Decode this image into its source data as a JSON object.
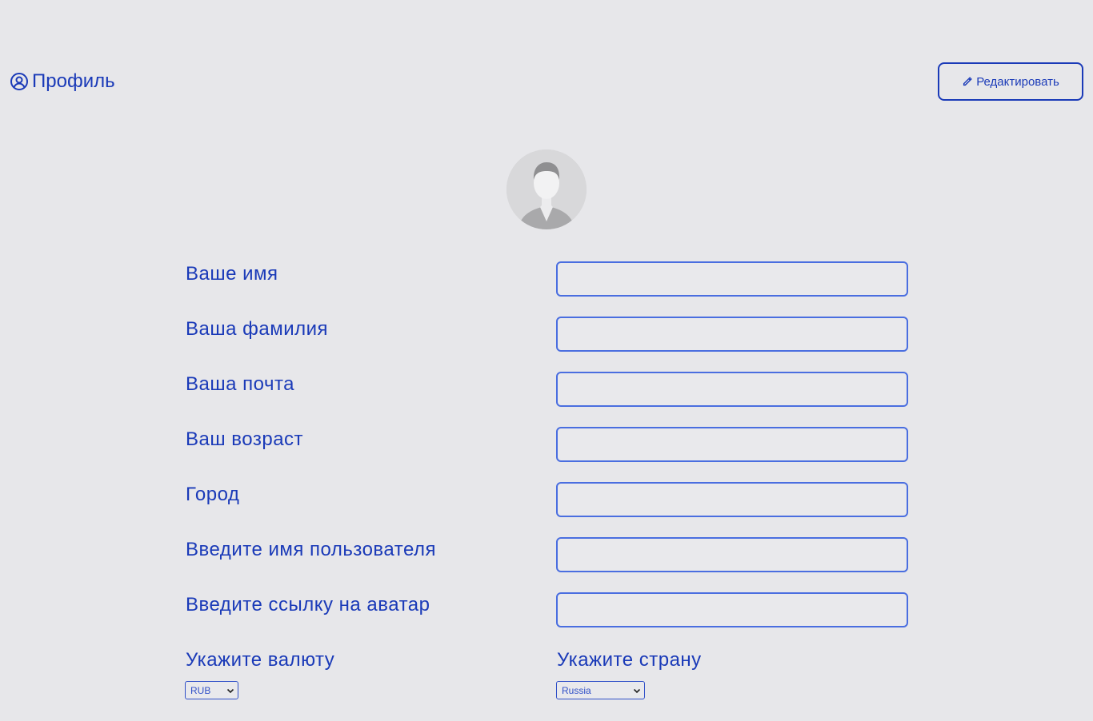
{
  "header": {
    "title": "Профиль",
    "title_icon": "user-circle-icon",
    "edit_label": "Редактировать",
    "edit_icon": "pencil-icon"
  },
  "avatar": {
    "icon": "default-user-avatar"
  },
  "form": {
    "fields": [
      {
        "label": "Ваше имя",
        "value": ""
      },
      {
        "label": "Ваша фамилия",
        "value": ""
      },
      {
        "label": "Ваша почта",
        "value": ""
      },
      {
        "label": "Ваш возраст",
        "value": ""
      },
      {
        "label": "Город",
        "value": ""
      },
      {
        "label": "Введите имя пользователя",
        "value": ""
      },
      {
        "label": "Введите ссылку на аватар",
        "value": ""
      }
    ],
    "currency": {
      "label": "Укажите валюту",
      "selected": "RUB"
    },
    "country": {
      "label": "Укажите страну",
      "selected": "Russia"
    }
  },
  "colors": {
    "background": "#e7e7ea",
    "accent": "#1a3ab8",
    "input_border": "#4a6ee0"
  }
}
